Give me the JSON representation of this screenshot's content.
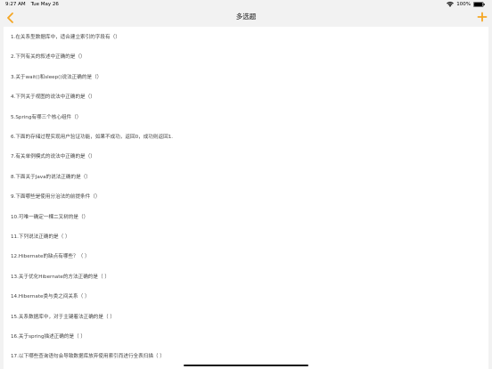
{
  "status_bar": {
    "time": "9:27 AM",
    "date": "Tue May 26",
    "battery_percent": "100%",
    "wifi_icon": "wifi-icon",
    "battery_icon": "battery-icon"
  },
  "nav": {
    "title": "多选题",
    "back_icon": "chevron-left-icon",
    "add_icon": "plus-icon",
    "accent_color": "#f5a623"
  },
  "questions": [
    "1.在关系型数据库中，适合建立索引的字段有（）",
    "2.下列有关的叙述中正确的是（）",
    "3.关于wait()和sleep()说法正确的是（）",
    "4.下列关于视图的说法中正确的是（）",
    "5.Spring有哪三个核心组件（）",
    "6.下面的存储过程实现用户验证功能，如果不成功，返回0，成功则返回1.",
    "7.有关单例模式的说法中正确的是（）",
    "8.下面关于Java的说法正确的是（）",
    "9.下面哪些是使用分治法的前提条件（）",
    "10.可唯一确定一棵二叉树的是（）",
    "11.下列说法正确的是（ ）",
    "12.Hibernate的缺点有哪些？（ ）",
    "13.关于优化Hibernate的方法正确的是（ ）",
    "14.Hibernate类与类之间关系（ ）",
    "15.关系数据库中，对于主键着法正确的是（ ）",
    "16.关于spring描述正确的是（ ）",
    "17.以下哪些查询语句会导致数据库放弃使用索引而进行全表扫描（ ）"
  ]
}
